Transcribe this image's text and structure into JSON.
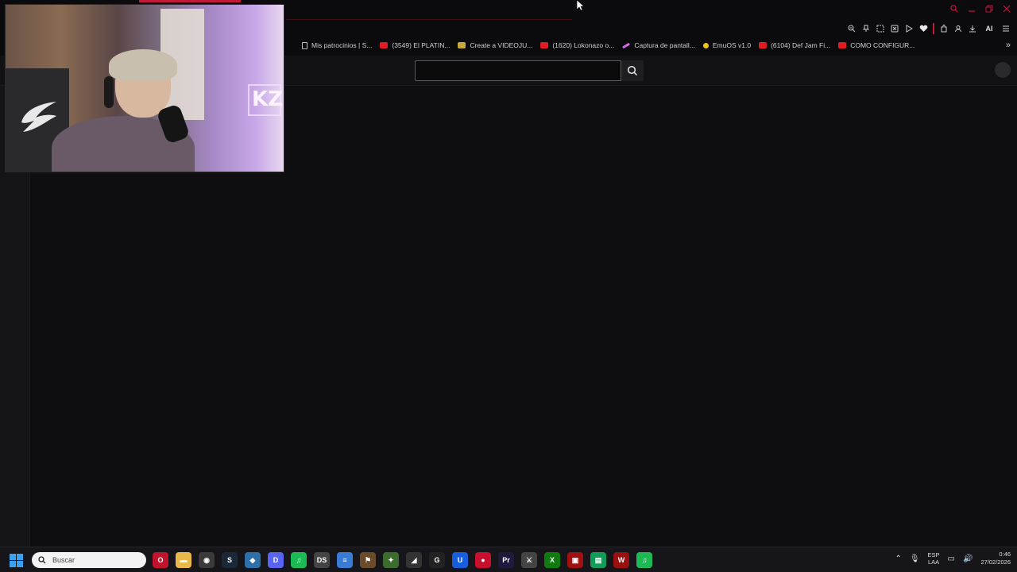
{
  "window": {
    "controls": [
      "search",
      "minimize",
      "restore",
      "close"
    ]
  },
  "toolbar": {
    "icons": [
      "zoom-icon",
      "pin-icon",
      "snapshot-icon",
      "shield-icon",
      "play-icon",
      "heart-icon",
      "extensions-icon",
      "profile-icon",
      "download-icon"
    ],
    "ai_label": "AI"
  },
  "bookmarks": [
    {
      "label": "Mis patrocinios | S...",
      "icon": "doc"
    },
    {
      "label": "(3549) El PLATIN...",
      "icon": "yt"
    },
    {
      "label": "Create a VIDEOJU...",
      "icon": "vid"
    },
    {
      "label": "(1620) Lokonazo o...",
      "icon": "yt"
    },
    {
      "label": "Captura de pantall...",
      "icon": "cap"
    },
    {
      "label": "EmuOS v1.0",
      "icon": "emu"
    },
    {
      "label": "(6104) Def Jam Fi...",
      "icon": "yt"
    },
    {
      "label": "COMO CONFIGUR...",
      "icon": "yt"
    }
  ],
  "search": {
    "placeholder": "",
    "value": ""
  },
  "webcam": {
    "neon_text": "KZ"
  },
  "taskbar": {
    "search_placeholder": "Buscar",
    "apps": [
      {
        "name": "opera-gx",
        "color": "#c0142c",
        "glyph": "O"
      },
      {
        "name": "file-explorer",
        "color": "#e8b84a",
        "glyph": "▬"
      },
      {
        "name": "chrome",
        "color": "#3a3a3a",
        "glyph": "◉"
      },
      {
        "name": "steam",
        "color": "#1b2838",
        "glyph": "S"
      },
      {
        "name": "app-shield",
        "color": "#2d6fa8",
        "glyph": "◆"
      },
      {
        "name": "discord",
        "color": "#5865f2",
        "glyph": "D"
      },
      {
        "name": "spotify",
        "color": "#1db954",
        "glyph": "♫"
      },
      {
        "name": "ds-emulator",
        "color": "#444",
        "glyph": "DS"
      },
      {
        "name": "notepad",
        "color": "#3a7bd5",
        "glyph": "≡"
      },
      {
        "name": "game-app-1",
        "color": "#6b4c2a",
        "glyph": "⚑"
      },
      {
        "name": "game-app-2",
        "color": "#3c6b2e",
        "glyph": "✦"
      },
      {
        "name": "racing-game",
        "color": "#333",
        "glyph": "◢"
      },
      {
        "name": "logitech",
        "color": "#222",
        "glyph": "G"
      },
      {
        "name": "bitwarden",
        "color": "#175ddc",
        "glyph": "U"
      },
      {
        "name": "game-app-3",
        "color": "#c8102e",
        "glyph": "●"
      },
      {
        "name": "premiere",
        "color": "#1f1a3d",
        "glyph": "Pr"
      },
      {
        "name": "game-app-4",
        "color": "#444",
        "glyph": "⚔"
      },
      {
        "name": "xbox",
        "color": "#107c10",
        "glyph": "X"
      },
      {
        "name": "game-app-5",
        "color": "#a01010",
        "glyph": "▣"
      },
      {
        "name": "sheets",
        "color": "#0f9d58",
        "glyph": "▤"
      },
      {
        "name": "game-app-6",
        "color": "#9a1010",
        "glyph": "W"
      },
      {
        "name": "spotify-2",
        "color": "#1db954",
        "glyph": "♫"
      }
    ],
    "lang_line1": "ESP",
    "lang_line2": "LAA",
    "time": "0:46",
    "date": "27/02/2026"
  },
  "colors": {
    "accent": "#c2183a",
    "taskbar": "#16161a",
    "page": "#0e0e10"
  }
}
